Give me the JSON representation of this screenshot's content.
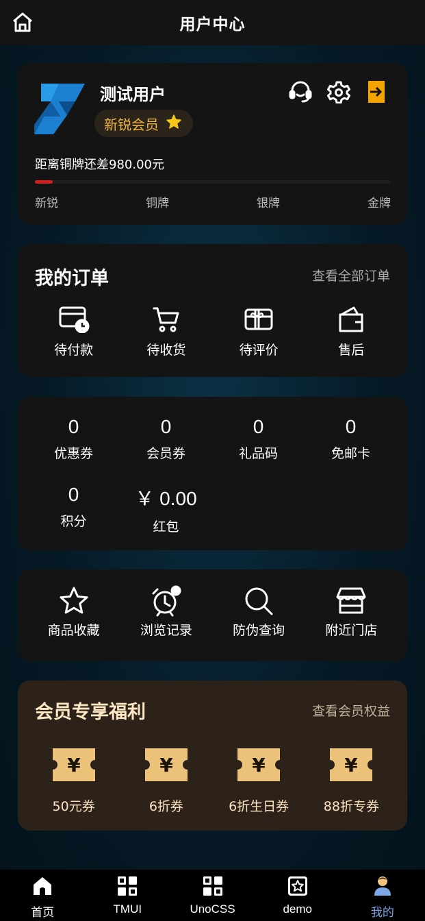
{
  "header": {
    "title": "用户中心",
    "home_icon": "home-icon"
  },
  "profile": {
    "username": "测试用户",
    "member_level": "新锐会员",
    "level_icon": "star-icon",
    "diff_text": "距离铜牌还差980.00元",
    "progress": 0.05,
    "levels": [
      "新锐",
      "铜牌",
      "银牌",
      "金牌"
    ],
    "icons": [
      "headset-icon",
      "settings-icon",
      "logout-icon"
    ],
    "accent": "#f0b443",
    "progress_color": "#d31e1e"
  },
  "orders": {
    "title": "我的订单",
    "view_all": "查看全部订单",
    "items": [
      {
        "label": "待付款",
        "icon": "wallet-clock-icon"
      },
      {
        "label": "待收货",
        "icon": "cart-icon"
      },
      {
        "label": "待评价",
        "icon": "gift-card-icon"
      },
      {
        "label": "售后",
        "icon": "wallet-icon"
      }
    ]
  },
  "stats": {
    "items": [
      {
        "value": "0",
        "label": "优惠券"
      },
      {
        "value": "0",
        "label": "会员券"
      },
      {
        "value": "0",
        "label": "礼品码"
      },
      {
        "value": "0",
        "label": "免邮卡"
      },
      {
        "value": "0",
        "label": "积分"
      },
      {
        "value": "￥ 0.00",
        "label": "红包"
      }
    ]
  },
  "tools": {
    "items": [
      {
        "label": "商品收藏",
        "icon": "star-outline-icon"
      },
      {
        "label": "浏览记录",
        "icon": "alarm-clock-icon"
      },
      {
        "label": "防伪查询",
        "icon": "search-icon"
      },
      {
        "label": "附近门店",
        "icon": "store-icon"
      }
    ]
  },
  "benefits": {
    "title": "会员专享福利",
    "view_all": "查看会员权益",
    "items": [
      {
        "label": "50元券",
        "icon": "coupon-icon"
      },
      {
        "label": "6折券",
        "icon": "coupon-icon"
      },
      {
        "label": "6折生日券",
        "icon": "coupon-icon"
      },
      {
        "label": "88折专券",
        "icon": "coupon-icon"
      }
    ],
    "coupon_symbol": "¥",
    "coupon_color": "#ecc27a"
  },
  "tabbar": {
    "items": [
      {
        "label": "首页",
        "icon": "home-tab-icon",
        "active": false
      },
      {
        "label": "TMUI",
        "icon": "grid-icon",
        "active": false
      },
      {
        "label": "UnoCSS",
        "icon": "grid-icon",
        "active": false
      },
      {
        "label": "demo",
        "icon": "star-box-icon",
        "active": false
      },
      {
        "label": "我的",
        "icon": "user-icon",
        "active": true
      }
    ],
    "active_color": "#7da7e6"
  }
}
